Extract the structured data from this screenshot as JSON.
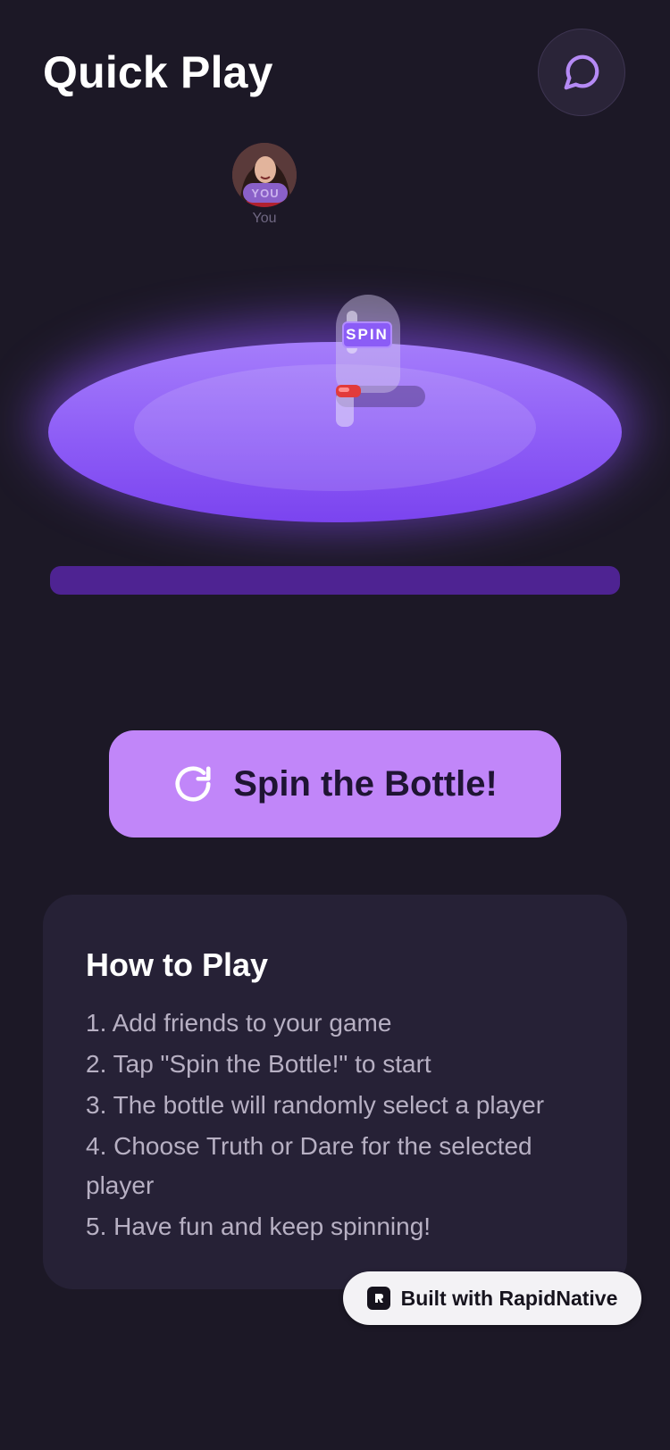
{
  "header": {
    "title": "Quick Play",
    "chat_icon": "message-circle-icon"
  },
  "players": [
    {
      "badge": "YOU",
      "name": "You"
    }
  ],
  "bottle": {
    "label": "SPIN"
  },
  "spin_button": {
    "label": "Spin the Bottle!",
    "icon": "refresh-icon"
  },
  "how_to_play": {
    "title": "How to Play",
    "steps": [
      "1. Add friends to your game",
      "2. Tap \"Spin the Bottle!\" to start",
      "3. The bottle will randomly select a player",
      "4. Choose Truth or Dare for the selected player",
      "5. Have fun and keep spinning!"
    ]
  },
  "badge": {
    "label": "Built with RapidNative"
  },
  "colors": {
    "background": "#1c1826",
    "accent": "#c186f9",
    "table": "#8d5cf6",
    "card": "#262136"
  }
}
